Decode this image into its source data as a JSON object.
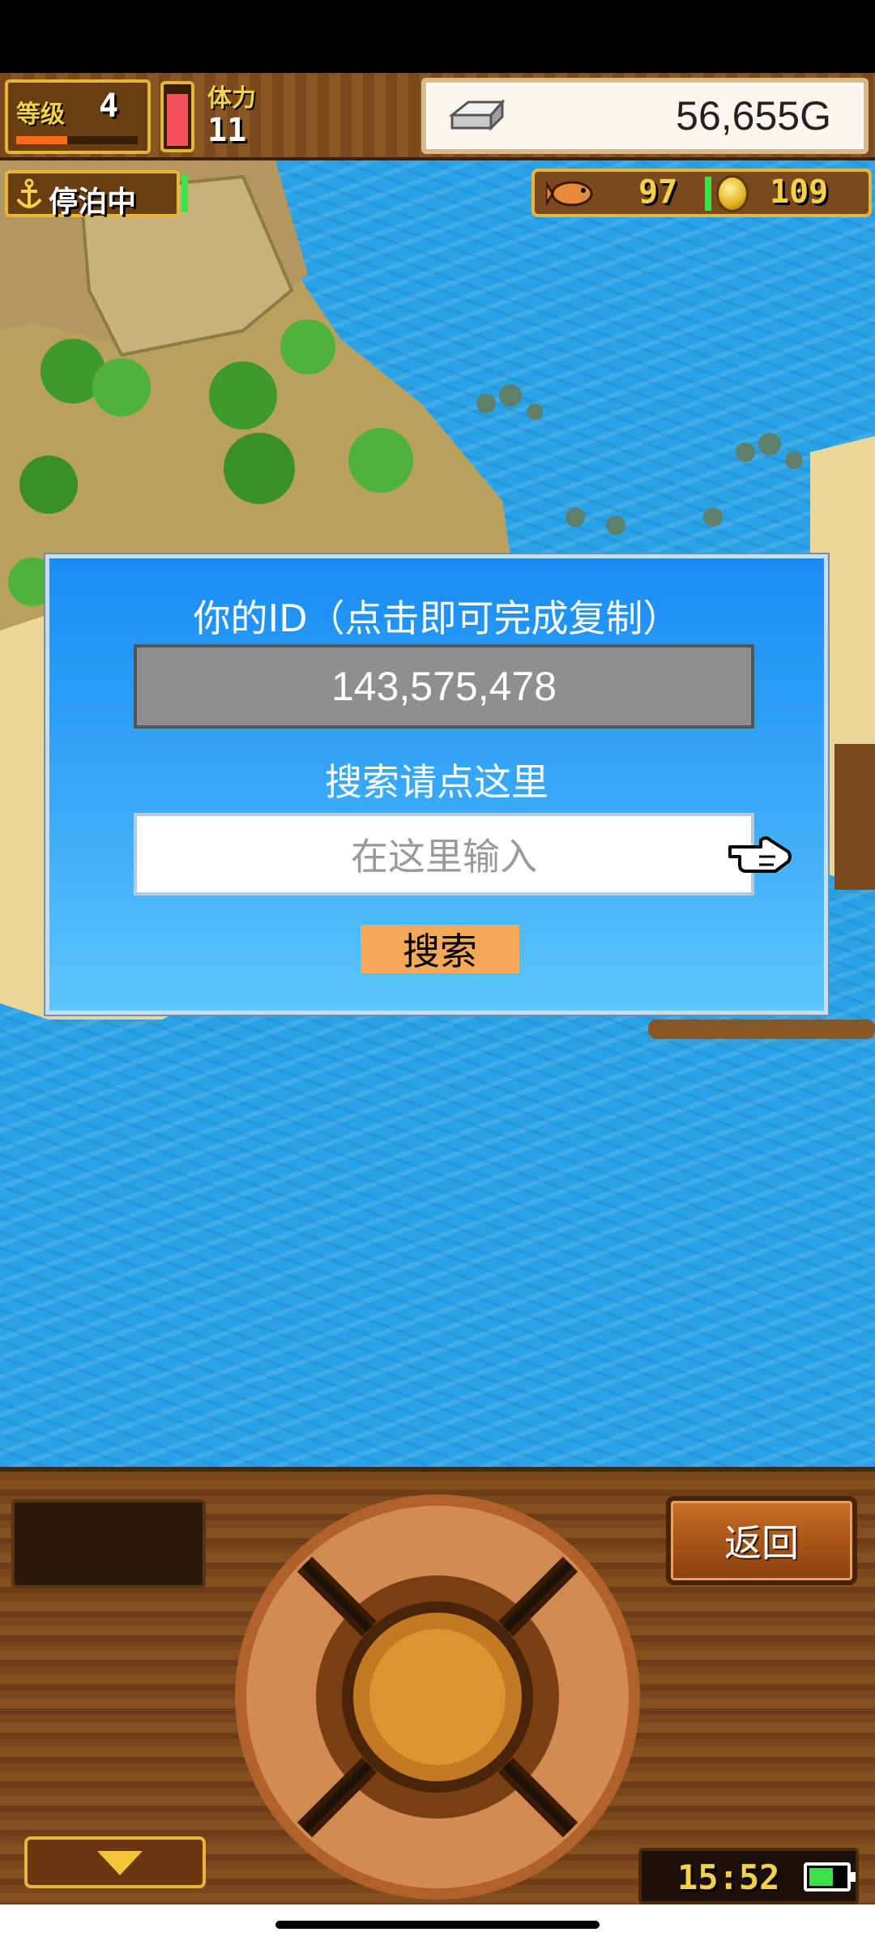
{
  "hud": {
    "level_label": "等级",
    "level_value": "4",
    "level_progress": 0.42,
    "stamina_label": "体力",
    "stamina_value": "11",
    "stamina_gauge_level": 0.9,
    "gold_value": "56,655G",
    "status_label": "停泊中",
    "food_value": "97",
    "medal_value": "109"
  },
  "dialog": {
    "title": "你的ID（点击即可完成复制）",
    "id_value": "143,575,478",
    "search_label": "搜索请点这里",
    "input_placeholder": "在这里输入",
    "search_button": "搜索"
  },
  "controls": {
    "back_button": "返回",
    "clock": "15:52",
    "battery_level": 0.7
  },
  "colors": {
    "sea": "#2aa3e6",
    "dialog_top": "#1a8cf5",
    "dialog_bottom": "#5cc6fb",
    "search_button": "#f4a85a",
    "hud_gold_text": "#f4d14a"
  },
  "icons": [
    "silver-bar-icon",
    "anchor-icon",
    "fish-icon",
    "coin-icon",
    "pointing-hand-icon",
    "steering-wheel-icon",
    "down-arrow-icon",
    "battery-icon"
  ]
}
